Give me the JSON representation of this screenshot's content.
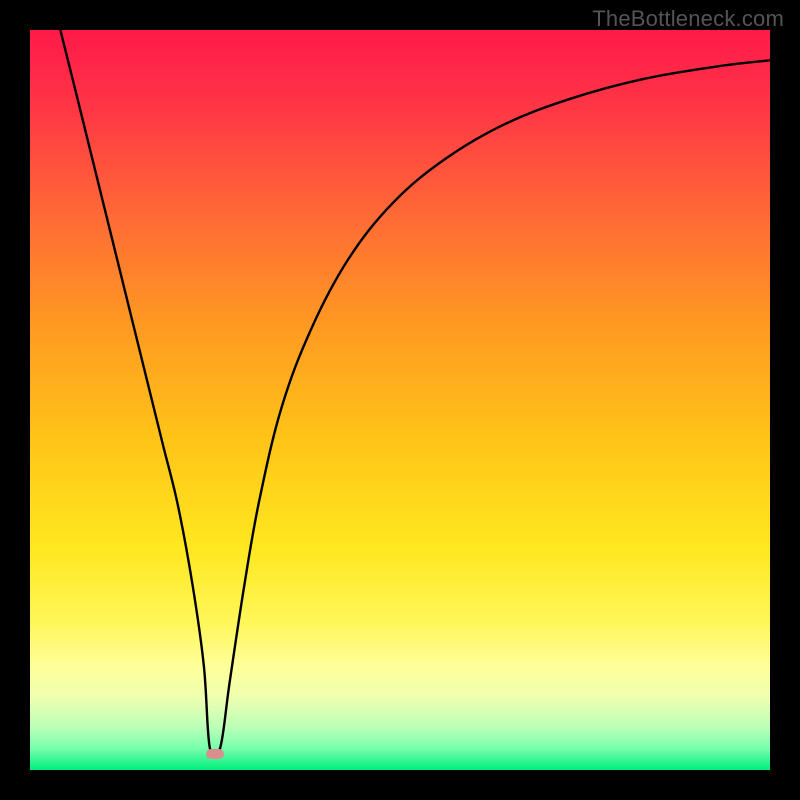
{
  "watermark": "TheBottleneck.com",
  "chart_data": {
    "type": "line",
    "title": "",
    "xlabel": "",
    "ylabel": "",
    "xlim": [
      0,
      100
    ],
    "ylim": [
      0,
      100
    ],
    "gradient_stops": [
      {
        "pos": 0,
        "color": "#ff1a4a"
      },
      {
        "pos": 10,
        "color": "#ff3546"
      },
      {
        "pos": 25,
        "color": "#ff6a36"
      },
      {
        "pos": 40,
        "color": "#ff9a22"
      },
      {
        "pos": 55,
        "color": "#ffc418"
      },
      {
        "pos": 70,
        "color": "#ffe820"
      },
      {
        "pos": 80,
        "color": "#fff75a"
      },
      {
        "pos": 86,
        "color": "#ffff9a"
      },
      {
        "pos": 90,
        "color": "#f0ffb0"
      },
      {
        "pos": 94,
        "color": "#c0ffb8"
      },
      {
        "pos": 97,
        "color": "#7affad"
      },
      {
        "pos": 100,
        "color": "#00ef7e"
      }
    ],
    "series": [
      {
        "name": "bottleneck-curve",
        "x": [
          4.1,
          6,
          8,
          10,
          12,
          14,
          16,
          18,
          20,
          22,
          23.5,
          24.3,
          25.7,
          27,
          29,
          31,
          34,
          38,
          43,
          49,
          56,
          64,
          73,
          83,
          93,
          100
        ],
        "y": [
          100,
          92.4,
          84.3,
          76.2,
          68.1,
          60.0,
          51.9,
          43.8,
          35.7,
          24.8,
          14.0,
          3.0,
          3.0,
          12.0,
          25.2,
          36.5,
          49.0,
          59.6,
          69.0,
          76.6,
          82.5,
          87.2,
          90.7,
          93.4,
          95.1,
          95.9
        ]
      }
    ],
    "minimum_marker": {
      "x": 25.0,
      "y": 2.2
    },
    "grid": false,
    "legend": false
  },
  "colors": {
    "curve": "#000000",
    "background": "#000000",
    "marker": "#da8f8f"
  }
}
